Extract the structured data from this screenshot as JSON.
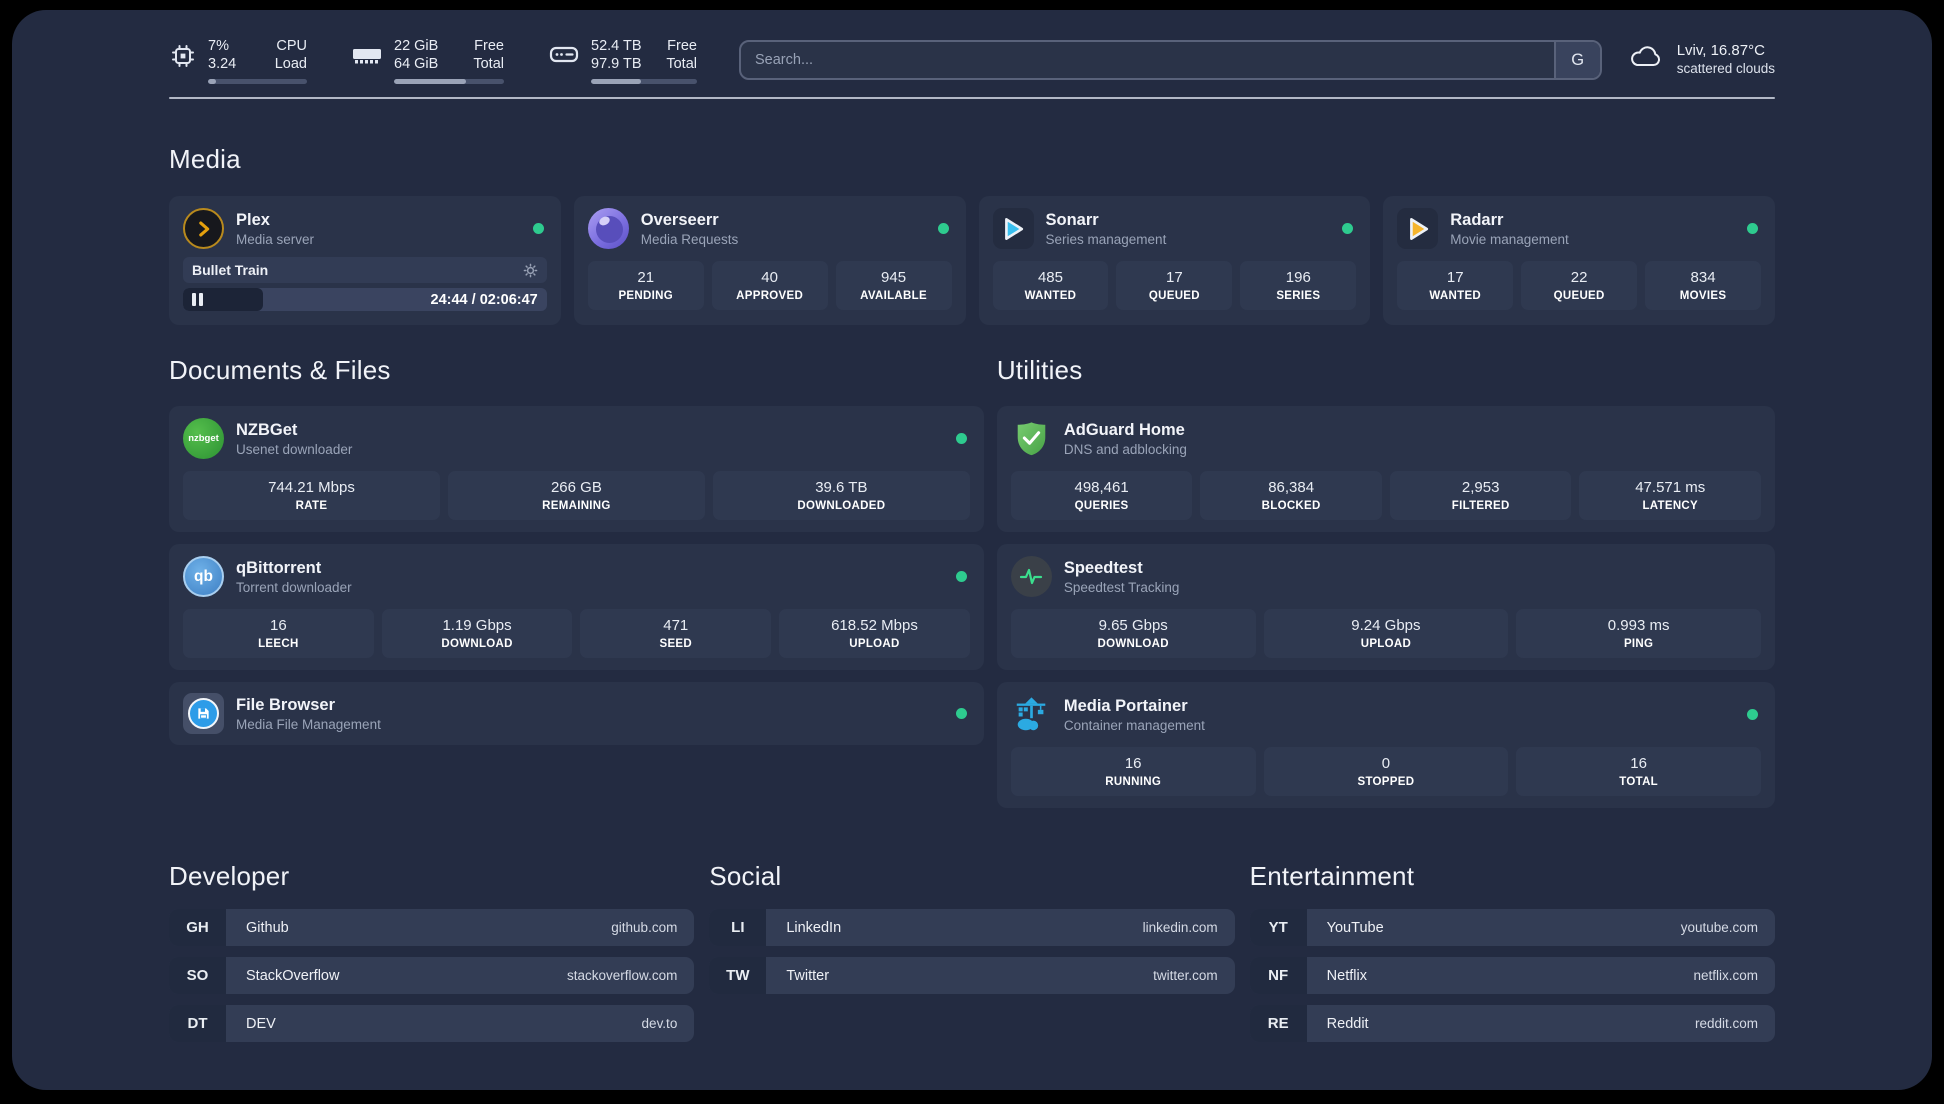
{
  "colors": {
    "status_online": "#2ecb8f",
    "plex_accent": "#e5a00d",
    "sonarr_accent": "#39bfef",
    "radarr_accent": "#f5b42c",
    "nzbget_accent": "#3aa93f",
    "qbittorrent_accent": "#4e96d9",
    "filebrowser_accent": "#2d9ce8",
    "adguard_accent": "#67bb5f",
    "speedtest_accent": "#3bdf8e",
    "portainer_accent": "#2baae2"
  },
  "header": {
    "system": {
      "cpu": {
        "primary": "7%",
        "secondary": "3.24",
        "label_primary": "CPU",
        "label_secondary": "Load",
        "progress_pct": 8
      },
      "memory": {
        "primary": "22 GiB",
        "secondary": "64 GiB",
        "label_primary": "Free",
        "label_secondary": "Total",
        "progress_pct": 65
      },
      "disk": {
        "primary": "52.4 TB",
        "secondary": "97.9 TB",
        "label_primary": "Free",
        "label_secondary": "Total",
        "progress_pct": 47
      }
    },
    "search": {
      "placeholder": "Search...",
      "engine_label": "G"
    },
    "weather": {
      "location": "Lviv, 16.87°C",
      "condition": "scattered clouds"
    }
  },
  "media": {
    "title": "Media",
    "apps": [
      {
        "name": "Plex",
        "subtitle": "Media server",
        "online": true,
        "player": {
          "title": "Bullet Train",
          "state": "paused",
          "time": "24:44 / 02:06:47",
          "progress_pct": 22
        }
      },
      {
        "name": "Overseerr",
        "subtitle": "Media Requests",
        "online": true,
        "stats": [
          {
            "value": "21",
            "label": "PENDING"
          },
          {
            "value": "40",
            "label": "APPROVED"
          },
          {
            "value": "945",
            "label": "AVAILABLE"
          }
        ]
      },
      {
        "name": "Sonarr",
        "subtitle": "Series management",
        "online": true,
        "stats": [
          {
            "value": "485",
            "label": "WANTED"
          },
          {
            "value": "17",
            "label": "QUEUED"
          },
          {
            "value": "196",
            "label": "SERIES"
          }
        ]
      },
      {
        "name": "Radarr",
        "subtitle": "Movie management",
        "online": true,
        "stats": [
          {
            "value": "17",
            "label": "WANTED"
          },
          {
            "value": "22",
            "label": "QUEUED"
          },
          {
            "value": "834",
            "label": "MOVIES"
          }
        ]
      }
    ]
  },
  "documents": {
    "title": "Documents & Files",
    "apps": [
      {
        "name": "NZBGet",
        "subtitle": "Usenet downloader",
        "online": true,
        "icon_text": "nzbget",
        "stats": [
          {
            "value": "744.21 Mbps",
            "label": "RATE"
          },
          {
            "value": "266 GB",
            "label": "REMAINING"
          },
          {
            "value": "39.6 TB",
            "label": "DOWNLOADED"
          }
        ]
      },
      {
        "name": "qBittorrent",
        "subtitle": "Torrent downloader",
        "online": true,
        "icon_text": "qb",
        "stats": [
          {
            "value": "16",
            "label": "LEECH"
          },
          {
            "value": "1.19 Gbps",
            "label": "DOWNLOAD"
          },
          {
            "value": "471",
            "label": "SEED"
          },
          {
            "value": "618.52 Mbps",
            "label": "UPLOAD"
          }
        ]
      },
      {
        "name": "File Browser",
        "subtitle": "Media File Management",
        "online": true
      }
    ]
  },
  "utilities": {
    "title": "Utilities",
    "apps": [
      {
        "name": "AdGuard Home",
        "subtitle": "DNS and adblocking",
        "stats": [
          {
            "value": "498,461",
            "label": "QUERIES"
          },
          {
            "value": "86,384",
            "label": "BLOCKED"
          },
          {
            "value": "2,953",
            "label": "FILTERED"
          },
          {
            "value": "47.571 ms",
            "label": "LATENCY"
          }
        ]
      },
      {
        "name": "Speedtest",
        "subtitle": "Speedtest Tracking",
        "stats": [
          {
            "value": "9.65 Gbps",
            "label": "DOWNLOAD"
          },
          {
            "value": "9.24 Gbps",
            "label": "UPLOAD"
          },
          {
            "value": "0.993 ms",
            "label": "PING"
          }
        ]
      },
      {
        "name": "Media Portainer",
        "subtitle": "Container management",
        "online": true,
        "stats": [
          {
            "value": "16",
            "label": "RUNNING"
          },
          {
            "value": "0",
            "label": "STOPPED"
          },
          {
            "value": "16",
            "label": "TOTAL"
          }
        ]
      }
    ]
  },
  "links": {
    "developer": {
      "title": "Developer",
      "items": [
        {
          "abbr": "GH",
          "name": "Github",
          "url": "github.com"
        },
        {
          "abbr": "SO",
          "name": "StackOverflow",
          "url": "stackoverflow.com"
        },
        {
          "abbr": "DT",
          "name": "DEV",
          "url": "dev.to"
        }
      ]
    },
    "social": {
      "title": "Social",
      "items": [
        {
          "abbr": "LI",
          "name": "LinkedIn",
          "url": "linkedin.com"
        },
        {
          "abbr": "TW",
          "name": "Twitter",
          "url": "twitter.com"
        }
      ]
    },
    "entertainment": {
      "title": "Entertainment",
      "items": [
        {
          "abbr": "YT",
          "name": "YouTube",
          "url": "youtube.com"
        },
        {
          "abbr": "NF",
          "name": "Netflix",
          "url": "netflix.com"
        },
        {
          "abbr": "RE",
          "name": "Reddit",
          "url": "reddit.com"
        }
      ]
    }
  }
}
